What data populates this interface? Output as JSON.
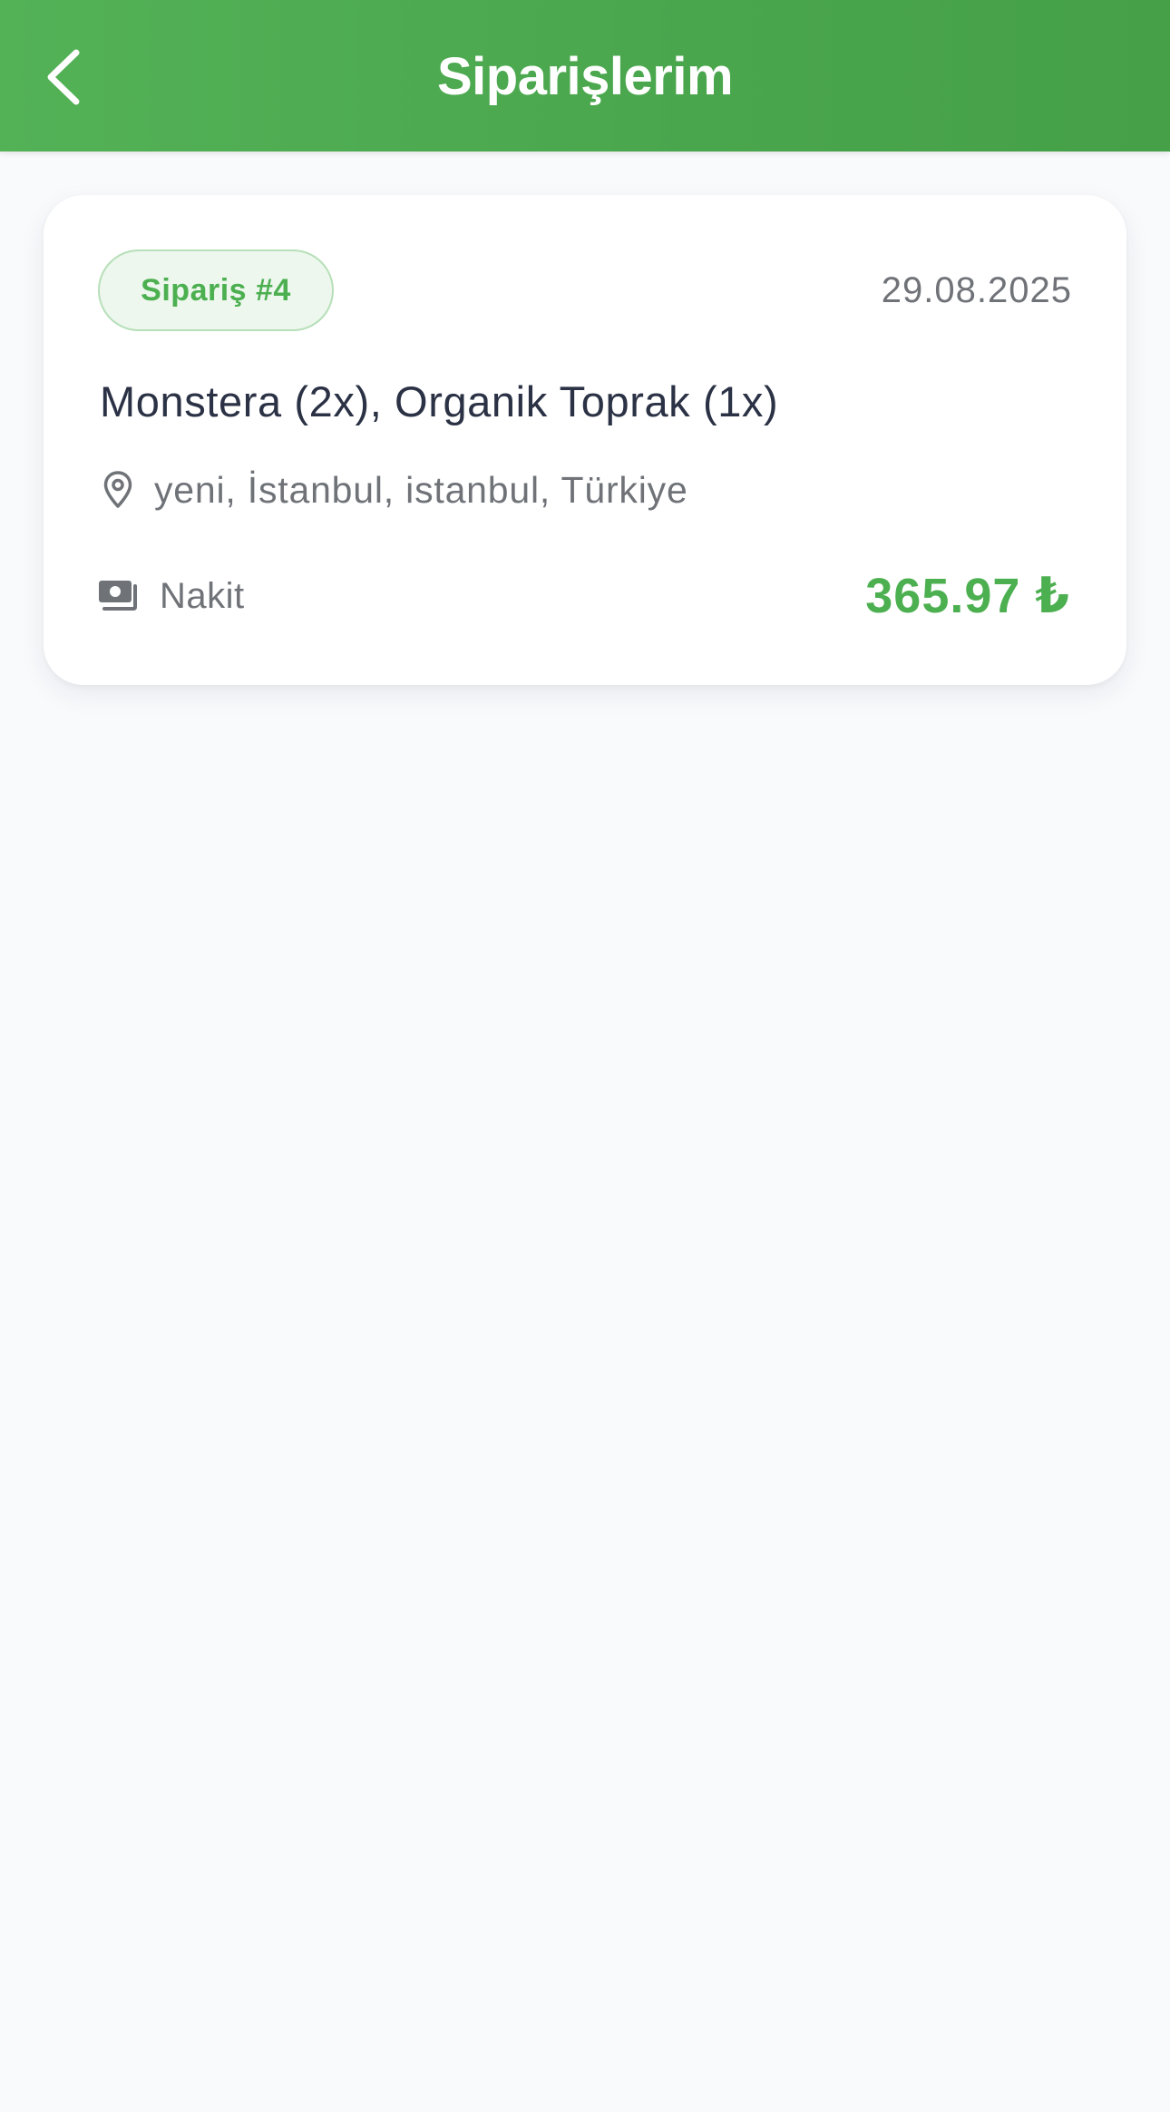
{
  "header": {
    "title": "Siparişlerim",
    "back_icon": "chevron-left-icon",
    "background_color": "#4CAF50"
  },
  "orders": [
    {
      "badge": "Sipariş #4",
      "date": "29.08.2025",
      "items": "Monstera (2x), Organik Toprak (1x)",
      "address_icon": "location-pin-icon",
      "address": "yeni, İstanbul, istanbul, Türkiye",
      "payment_icon": "cash-icon",
      "payment_method": "Nakit",
      "total": "365.97 ₺",
      "accent_color": "#4CAF50"
    }
  ]
}
